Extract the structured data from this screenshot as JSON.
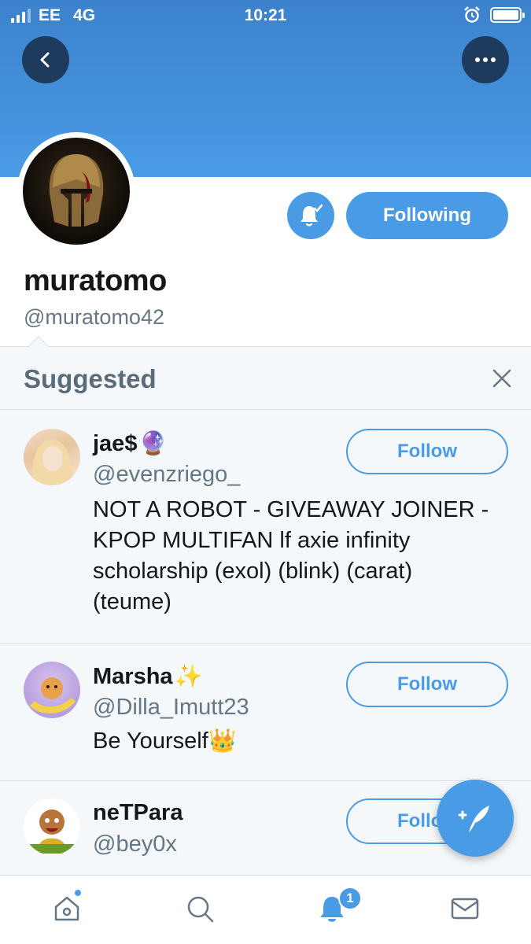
{
  "status_bar": {
    "carrier": "EE",
    "network": "4G",
    "time": "10:21"
  },
  "header": {
    "back_icon": "chevron-left-icon",
    "more_icon": "ellipsis-icon"
  },
  "profile": {
    "display_name": "muratomo",
    "handle": "@muratomo42",
    "following_label": "Following",
    "notify_icon": "bell-check-icon"
  },
  "suggested": {
    "title": "Suggested",
    "users": [
      {
        "name": "jae$",
        "name_emoji": "🔮",
        "handle": "@evenzriego_",
        "bio": "NOT A ROBOT - GIVEAWAY JOINER - KPOP MULTIFAN lf axie infinity scholarship (exol) (blink) (carat) (teume)",
        "follow_label": "Follow"
      },
      {
        "name": "Marsha",
        "name_emoji": "✨",
        "handle": "@Dilla_Imutt23",
        "bio": "Be Yourself👑",
        "follow_label": "Follow"
      },
      {
        "name": "neTPara",
        "name_emoji": "",
        "handle": "@bey0x",
        "bio": "",
        "follow_label": "Follow"
      }
    ]
  },
  "tabbar": {
    "items": [
      "home-icon",
      "search-icon",
      "notifications-icon",
      "messages-icon"
    ],
    "notification_count": "1"
  },
  "colors": {
    "accent": "#4a9be6",
    "banner": "#3c82cc",
    "text": "#14171a",
    "muted": "#657786"
  }
}
